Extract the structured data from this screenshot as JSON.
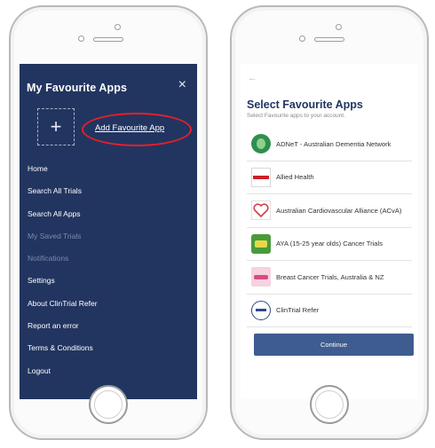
{
  "left_screen": {
    "title": "My Favourite Apps",
    "close_icon": "×",
    "add_icon": "+",
    "add_link": "Add Favourite App",
    "menu": [
      {
        "label": "Home",
        "disabled": false
      },
      {
        "label": "Search All Trials",
        "disabled": false
      },
      {
        "label": "Search All Apps",
        "disabled": false
      },
      {
        "label": "My Saved Trials",
        "disabled": true
      },
      {
        "label": "Notifications",
        "disabled": true
      },
      {
        "label": "Settings",
        "disabled": false
      },
      {
        "label": "About ClinTrial Refer",
        "disabled": false
      },
      {
        "label": "Report an error",
        "disabled": false
      },
      {
        "label": "Terms & Conditions",
        "disabled": false
      },
      {
        "label": "Logout",
        "disabled": false
      }
    ],
    "colors": {
      "background": "#223560",
      "highlight": "#e8202a",
      "disabled_text": "#7b8aab"
    }
  },
  "right_screen": {
    "back_icon": "←",
    "title": "Select Favourite Apps",
    "subtitle": "Select Favourite apps to your account.",
    "apps": [
      {
        "name": "ADNeT - Australian Dementia Network",
        "icon": "brain-logo"
      },
      {
        "name": "Allied Health",
        "icon": "allied-health-logo"
      },
      {
        "name": "Australian Cardiovascular Alliance (ACvA)",
        "icon": "heart-logo"
      },
      {
        "name": "AYA (15-25 year olds) Cancer Trials",
        "icon": "aya-logo"
      },
      {
        "name": "Breast Cancer Trials, Australia & NZ",
        "icon": "breast-cancer-trials-logo"
      },
      {
        "name": "ClinTrial Refer",
        "icon": "clintrial-refer-logo"
      }
    ],
    "continue_label": "Continue",
    "colors": {
      "title": "#223560",
      "button": "#3e5c8f"
    }
  }
}
